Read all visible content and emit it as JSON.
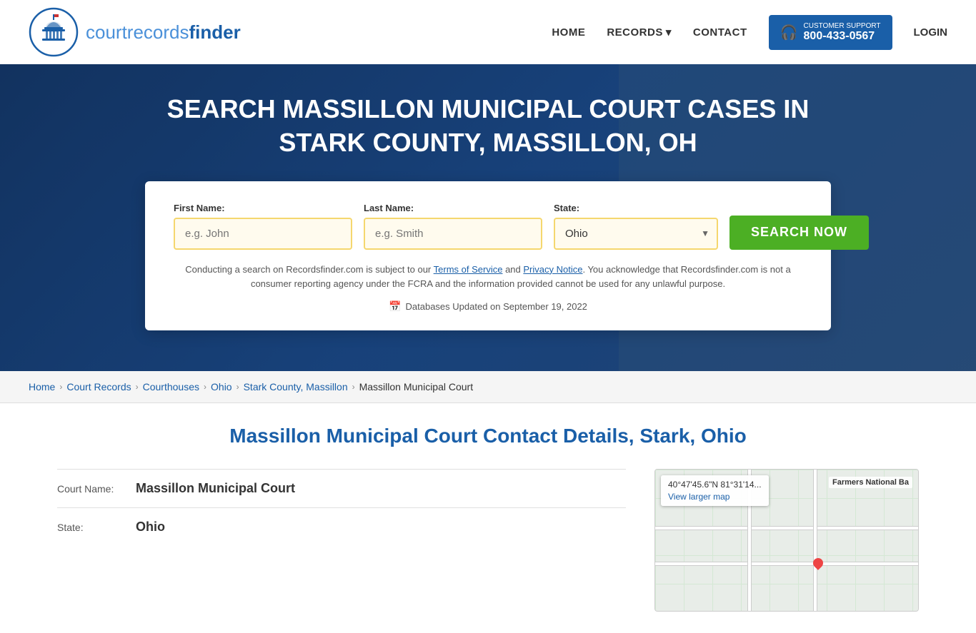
{
  "header": {
    "logo_text_light": "courtrecords",
    "logo_text_bold": "finder",
    "nav": {
      "home": "HOME",
      "records": "RECORDS",
      "contact": "CONTACT",
      "support_label": "CUSTOMER SUPPORT",
      "support_phone": "800-433-0567",
      "login": "LOGIN"
    }
  },
  "hero": {
    "title": "SEARCH MASSILLON MUNICIPAL COURT CASES IN STARK COUNTY, MASSILLON, OH",
    "form": {
      "first_name_label": "First Name:",
      "first_name_placeholder": "e.g. John",
      "last_name_label": "Last Name:",
      "last_name_placeholder": "e.g. Smith",
      "state_label": "State:",
      "state_value": "Ohio",
      "search_button": "SEARCH NOW",
      "disclaimer": "Conducting a search on Recordsfinder.com is subject to our ",
      "terms_link": "Terms of Service",
      "and_text": " and ",
      "privacy_link": "Privacy Notice",
      "disclaimer2": ". You acknowledge that Recordsfinder.com is not a consumer reporting agency under the FCRA and the information provided cannot be used for any unlawful purpose.",
      "db_update": "Databases Updated on September 19, 2022"
    }
  },
  "breadcrumb": {
    "items": [
      {
        "label": "Home",
        "href": "#"
      },
      {
        "label": "Court Records",
        "href": "#"
      },
      {
        "label": "Courthouses",
        "href": "#"
      },
      {
        "label": "Ohio",
        "href": "#"
      },
      {
        "label": "Stark County, Massillon",
        "href": "#"
      },
      {
        "label": "Massillon Municipal Court",
        "current": true
      }
    ]
  },
  "content": {
    "section_title": "Massillon Municipal Court Contact Details, Stark, Ohio",
    "court_name_label": "Court Name:",
    "court_name_value": "Massillon Municipal Court",
    "state_label": "State:",
    "state_value": "Ohio",
    "map": {
      "coords": "40°47'45.6\"N 81°31'14...",
      "view_larger": "View larger map",
      "label_right": "Farmers National Ba"
    }
  }
}
